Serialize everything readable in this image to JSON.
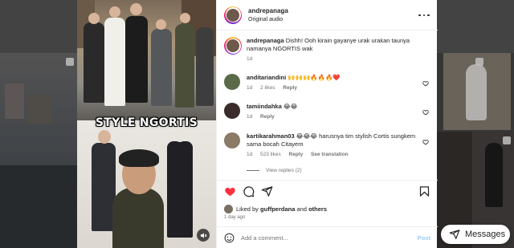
{
  "post": {
    "username": "andrepanaga",
    "audio": "Original audio",
    "image_title": "STYLE NGORTIS"
  },
  "caption": {
    "username": "andrepanaga",
    "text": "Dishh! Ooh kirain gayanye urak urakan taunya namanya NGORTIS wak",
    "time": "1d"
  },
  "comments": [
    {
      "username": "anditariandini",
      "text": "🙌🙌🙌🔥🔥🔥❤️",
      "time": "1d",
      "likes": "2 likes",
      "reply_label": "Reply",
      "translate_label": ""
    },
    {
      "username": "tamiindahka",
      "text": "😂😂",
      "time": "1d",
      "likes": "",
      "reply_label": "Reply",
      "translate_label": ""
    },
    {
      "username": "kartikarahman03",
      "text": "😂😂😂 harusnya tim stylish Cortis sungkem sama bocah Citayem",
      "time": "1d",
      "likes": "523 likes",
      "reply_label": "Reply",
      "translate_label": "See translation"
    }
  ],
  "view_replies": "View replies (2)",
  "likes_line": {
    "prefix": "Liked by",
    "user": "guffperdana",
    "and": "and",
    "others": "others"
  },
  "post_age": "1 day ago",
  "add_comment": {
    "placeholder": "Add a comment...",
    "post_label": "Post"
  },
  "messages_label": "Messages",
  "colors": {
    "like_red": "#ff3040",
    "link_blue": "#0095f6",
    "muted": "#737373"
  },
  "icons": [
    "more-icon",
    "heart-icon",
    "comment-icon",
    "share-icon",
    "bookmark-icon",
    "emoji-icon",
    "mute-icon",
    "messages-icon"
  ]
}
